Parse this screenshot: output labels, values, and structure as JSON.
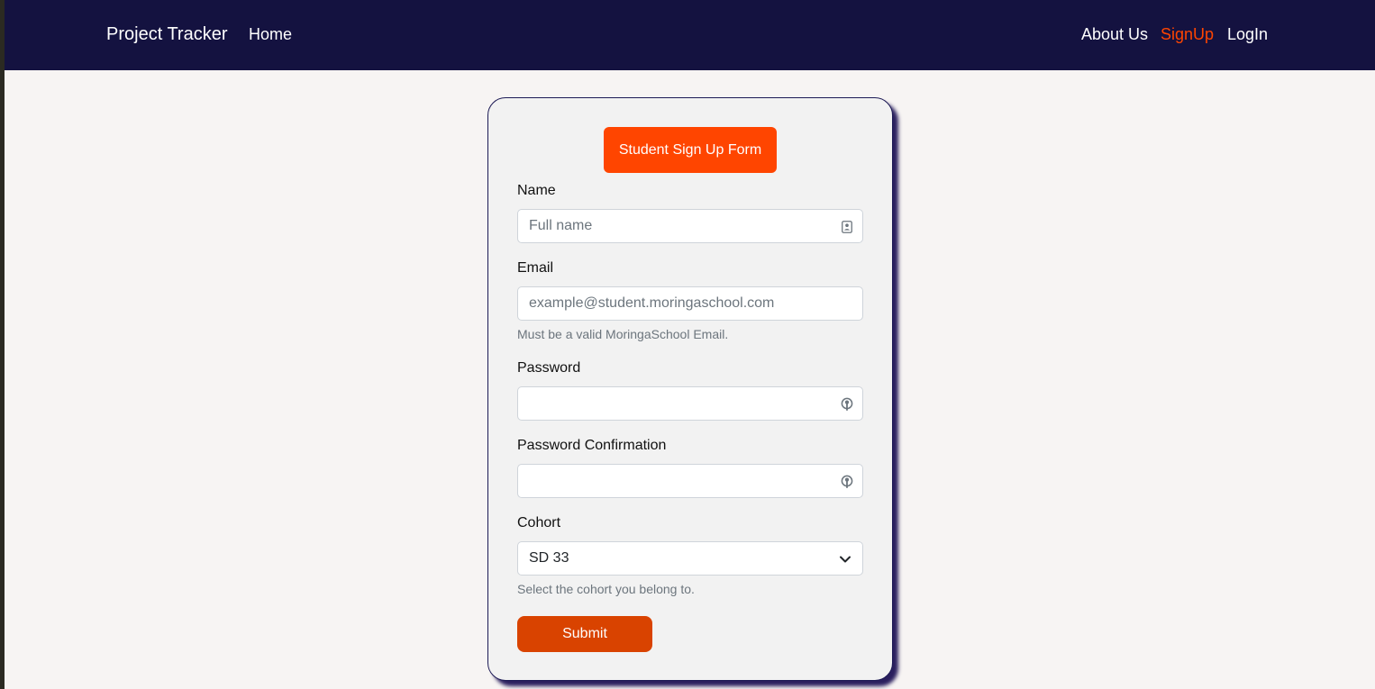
{
  "nav": {
    "brand": "Project Tracker",
    "home": "Home",
    "about": "About Us",
    "signup": "SignUp",
    "login": "LogIn",
    "active_color": "#ff4500"
  },
  "form": {
    "title": "Student Sign Up Form",
    "name": {
      "label": "Name",
      "placeholder": "Full name",
      "icon": "contact-card-icon"
    },
    "email": {
      "label": "Email",
      "placeholder": "example@student.moringaschool.com",
      "help": "Must be a valid MoringaSchool Email."
    },
    "password": {
      "label": "Password",
      "icon": "key-icon"
    },
    "password_confirmation": {
      "label": "Password Confirmation",
      "icon": "key-icon"
    },
    "cohort": {
      "label": "Cohort",
      "selected": "SD 33",
      "help": "Select the cohort you belong to."
    },
    "submit": "Submit"
  },
  "colors": {
    "navbar": "#141240",
    "title_bg": "#ff4500",
    "submit_bg": "#d94300",
    "page_bg": "#f7f4f3"
  }
}
